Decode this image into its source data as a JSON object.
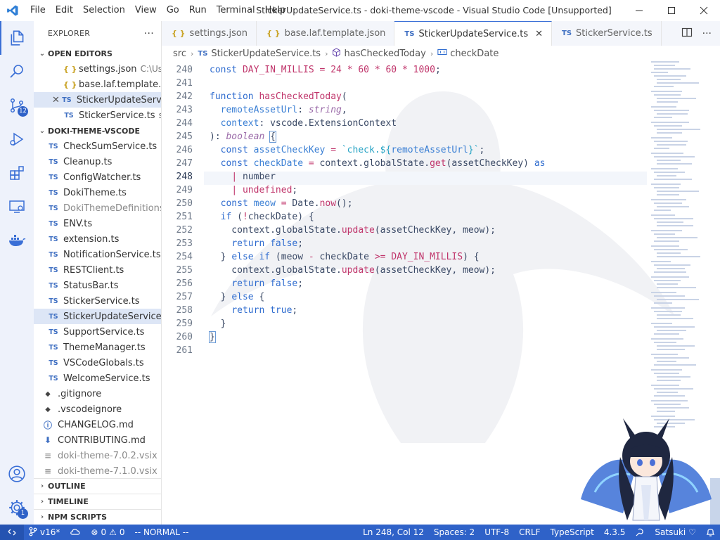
{
  "titlebar": {
    "menu": [
      "File",
      "Edit",
      "Selection",
      "View",
      "Go",
      "Run",
      "Terminal",
      "Help"
    ],
    "title": "StickerUpdateService.ts - doki-theme-vscode - Visual Studio Code [Unsupported]"
  },
  "activity": {
    "scm_badge": "12",
    "manage_badge": "1"
  },
  "sidebar": {
    "title": "EXPLORER",
    "more": "···",
    "open_editors_label": "OPEN EDITORS",
    "open_editors": [
      {
        "icon": "{ }",
        "name": "settings.json",
        "desc": "C:\\Us..."
      },
      {
        "icon": "{ }",
        "name": "base.laf.template.j..."
      },
      {
        "icon": "TS",
        "name": "StickerUpdateServ..."
      },
      {
        "icon": "TS",
        "name": "StickerService.ts",
        "desc": "src"
      }
    ],
    "project_label": "DOKI-THEME-VSCODE",
    "files": [
      {
        "icon": "TS",
        "name": "CheckSumService.ts"
      },
      {
        "icon": "TS",
        "name": "Cleanup.ts"
      },
      {
        "icon": "TS",
        "name": "ConfigWatcher.ts"
      },
      {
        "icon": "TS",
        "name": "DokiTheme.ts"
      },
      {
        "icon": "TS",
        "name": "DokiThemeDefinitions..."
      },
      {
        "icon": "TS",
        "name": "ENV.ts"
      },
      {
        "icon": "TS",
        "name": "extension.ts"
      },
      {
        "icon": "TS",
        "name": "NotificationService.ts"
      },
      {
        "icon": "TS",
        "name": "RESTClient.ts"
      },
      {
        "icon": "TS",
        "name": "StatusBar.ts"
      },
      {
        "icon": "TS",
        "name": "StickerService.ts"
      },
      {
        "icon": "TS",
        "name": "StickerUpdateService.ts"
      },
      {
        "icon": "TS",
        "name": "SupportService.ts"
      },
      {
        "icon": "TS",
        "name": "ThemeManager.ts"
      },
      {
        "icon": "TS",
        "name": "VSCodeGlobals.ts"
      },
      {
        "icon": "TS",
        "name": "WelcomeService.ts"
      }
    ],
    "root_files": [
      {
        "name": ".gitignore"
      },
      {
        "name": ".vscodeignore"
      },
      {
        "name": "CHANGELOG.md"
      },
      {
        "name": "CONTRIBUTING.md"
      },
      {
        "name": "doki-theme-7.0.2.vsix"
      },
      {
        "name": "doki-theme-7.1.0.vsix"
      }
    ],
    "bottom_sections": [
      "OUTLINE",
      "TIMELINE",
      "NPM SCRIPTS"
    ]
  },
  "tabs": [
    {
      "icon": "{ }",
      "label": "settings.json"
    },
    {
      "icon": "{ }",
      "label": "base.laf.template.json"
    },
    {
      "icon": "TS",
      "label": "StickerUpdateService.ts",
      "close": "✕"
    },
    {
      "icon": "TS",
      "label": "StickerService.ts"
    }
  ],
  "breadcrumb": {
    "folder": "src",
    "file_icon": "TS",
    "file": "StickerUpdateService.ts",
    "func": "hasCheckedToday",
    "var": "checkDate"
  },
  "code": {
    "line_numbers": [
      "240",
      "241",
      "242",
      "243",
      "244",
      "245",
      "246",
      "247",
      "248",
      "249",
      "250",
      "251",
      "252",
      "253",
      "254",
      "255",
      "256",
      "257",
      "258",
      "259",
      "260",
      "261"
    ]
  },
  "status": {
    "branch": "v16*",
    "errors": "0",
    "warnings": "0",
    "mode": "-- NORMAL --",
    "position": "Ln 248, Col 12",
    "spaces": "Spaces: 2",
    "encoding": "UTF-8",
    "eol": "CRLF",
    "language": "TypeScript",
    "version": "4.3.5",
    "theme": "Satsuki"
  }
}
